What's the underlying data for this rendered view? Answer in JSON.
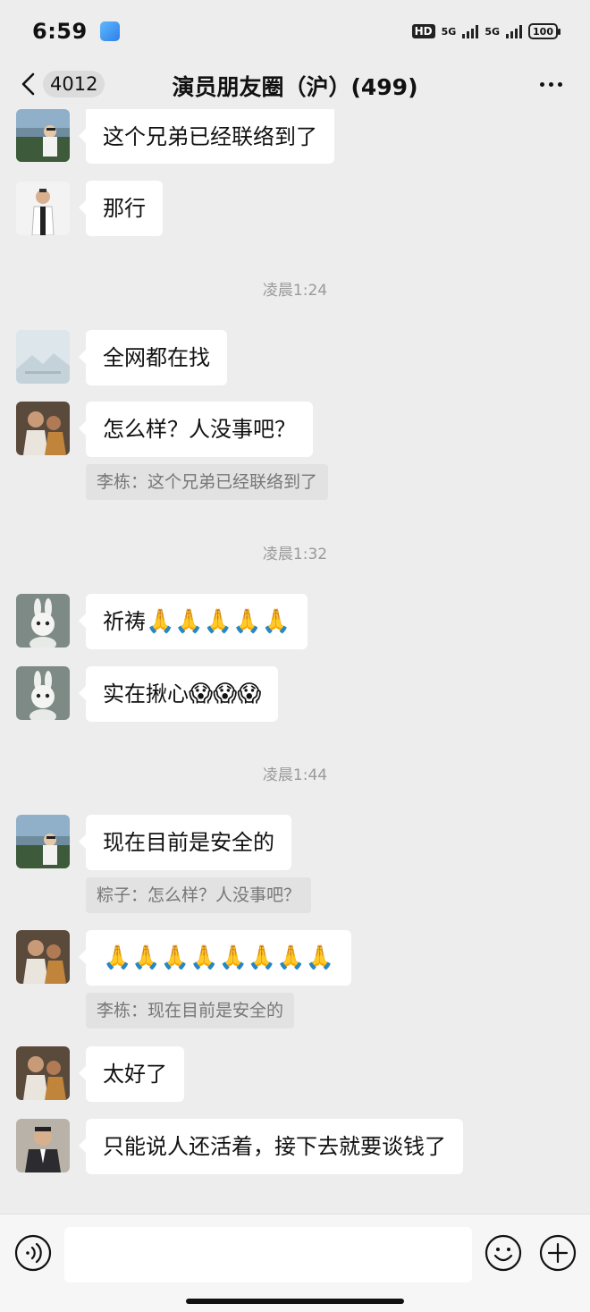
{
  "status_bar": {
    "time": "6:59",
    "hd": "HD",
    "sim1": "5G",
    "sim2": "5G",
    "battery": "100"
  },
  "header": {
    "unread": "4012",
    "title": "演员朋友圈（沪）(499)"
  },
  "messages": [
    {
      "text": "这个兄弟已经联络到了",
      "avatar": "avatar-landscape-man"
    },
    {
      "text": "那行",
      "avatar": "avatar-man-white-shirt"
    },
    {
      "text": "全网都在找",
      "avatar": "avatar-placeholder-image"
    },
    {
      "text": "怎么样？人没事吧？",
      "avatar": "avatar-couple-photo",
      "quote": "李栋：这个兄弟已经联络到了"
    },
    {
      "text": "祈祷",
      "avatar": "avatar-white-rabbit",
      "emoji": "🙏🙏🙏🙏🙏"
    },
    {
      "text": "实在揪心",
      "avatar": "avatar-white-rabbit",
      "emoji": "😱😱😱"
    },
    {
      "text": "现在目前是安全的",
      "avatar": "avatar-landscape-man",
      "quote": "粽子：怎么样？人没事吧？"
    },
    {
      "text": "",
      "avatar": "avatar-couple-photo",
      "emoji": "🙏🙏🙏🙏🙏🙏🙏🙏",
      "quote": "李栋：现在目前是安全的"
    },
    {
      "text": "太好了",
      "avatar": "avatar-couple-photo"
    },
    {
      "text": "只能说人还活着，接下去就要谈钱了",
      "avatar": "avatar-man-suit"
    }
  ],
  "timestamps": [
    "凌晨1:24",
    "凌晨1:32",
    "凌晨1:44"
  ],
  "input": {
    "placeholder": ""
  },
  "icons": {
    "back": "chevron-left-icon",
    "more": "more-dots-icon",
    "voice": "voice-icon",
    "emoji": "smiley-icon",
    "plus": "plus-icon"
  }
}
